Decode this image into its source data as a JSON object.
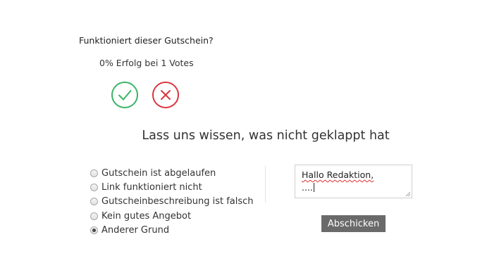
{
  "vote": {
    "question": "Funktioniert dieser Gutschein?",
    "success_text": "0% Erfolg bei 1 Votes",
    "yes_icon": "check-icon",
    "no_icon": "x-icon",
    "colors": {
      "yes": "#3ab464",
      "no": "#d9363e"
    }
  },
  "feedback": {
    "heading": "Lass uns wissen, was nicht geklappt hat",
    "reasons": [
      {
        "label": "Gutschein ist abgelaufen",
        "checked": false
      },
      {
        "label": "Link funktioniert nicht",
        "checked": false
      },
      {
        "label": "Gutscheinbeschreibung ist falsch",
        "checked": false
      },
      {
        "label": "Kein gutes Angebot",
        "checked": false
      },
      {
        "label": "Anderer Grund",
        "checked": true
      }
    ],
    "message": {
      "line1": "Hallo Redaktion,",
      "line2": "...."
    },
    "submit_label": "Abschicken"
  }
}
